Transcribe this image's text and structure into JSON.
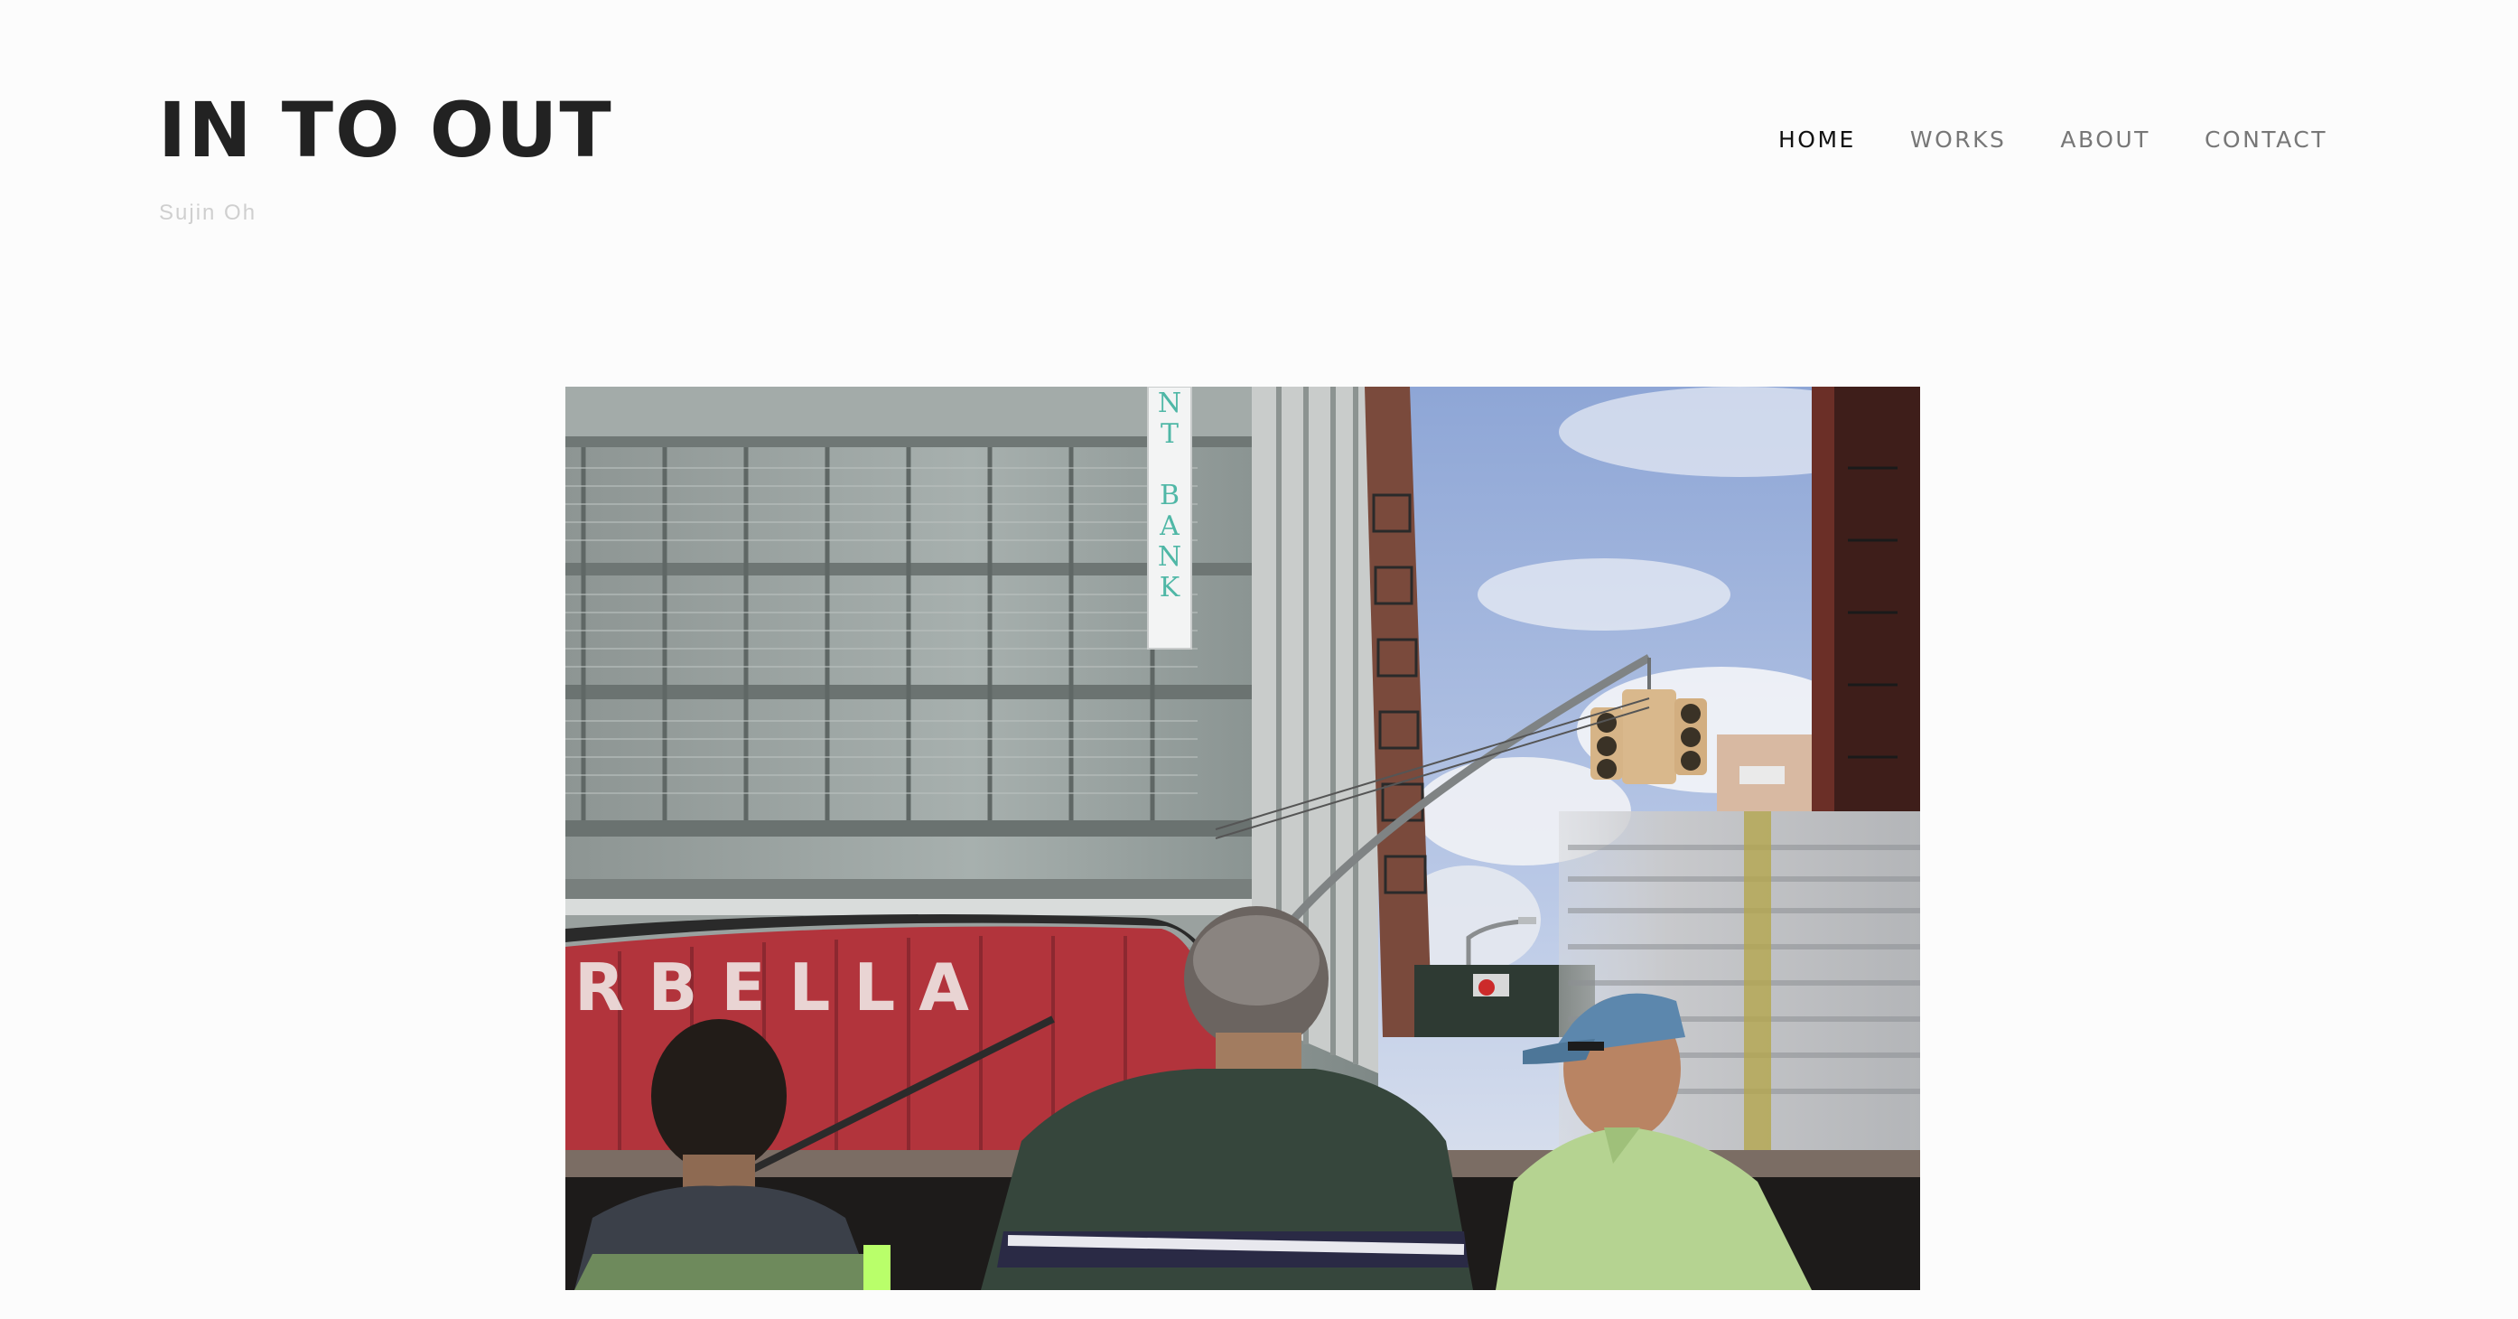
{
  "header": {
    "title": "IN TO OUT",
    "subtitle": "Sujin Oh"
  },
  "nav": {
    "items": [
      {
        "label": "HOME",
        "active": true
      },
      {
        "label": "WORKS",
        "active": false
      },
      {
        "label": "ABOUT",
        "active": false
      },
      {
        "label": "CONTACT",
        "active": false
      }
    ]
  },
  "hero": {
    "bank_sign_letters": [
      "N",
      "T",
      "B",
      "A",
      "N",
      "K"
    ],
    "container_text": "RBELLA"
  },
  "colors": {
    "background": "#fcfcfc",
    "title": "#222222",
    "subtitle": "#cfcfcf",
    "nav_active": "#111111",
    "nav_inactive": "#777777"
  }
}
